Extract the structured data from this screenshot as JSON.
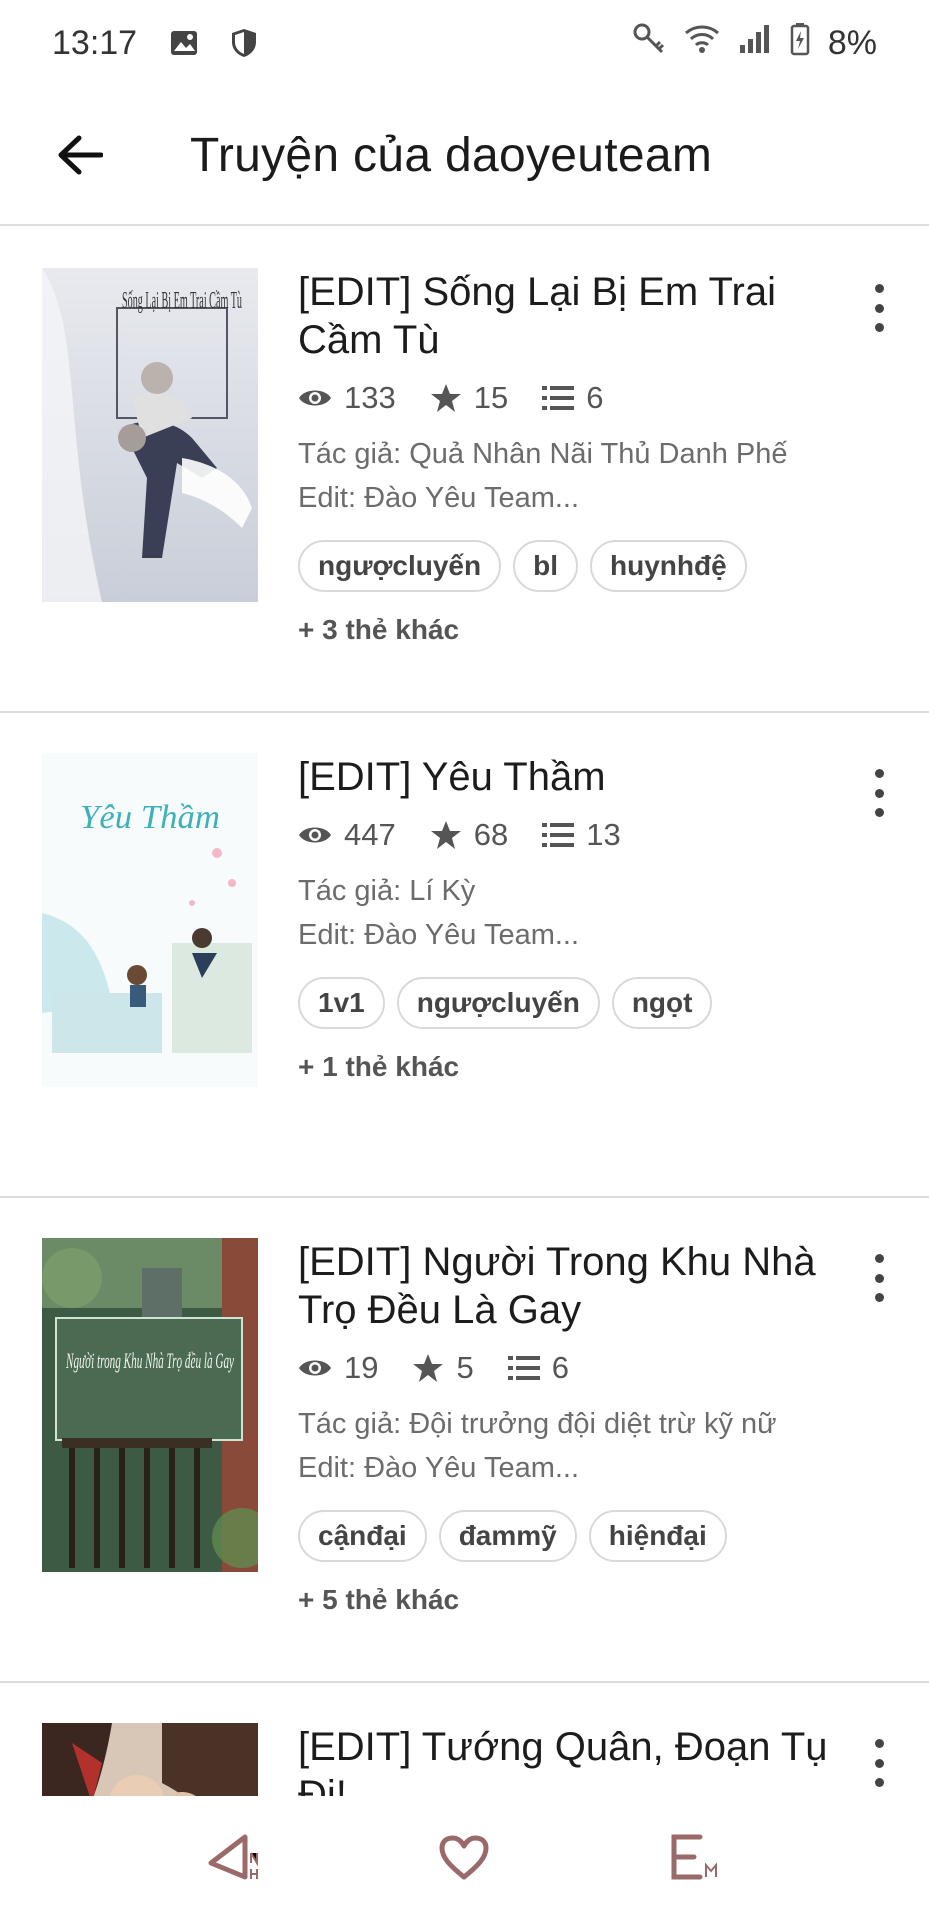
{
  "status": {
    "time": "13:17",
    "battery": "8%"
  },
  "header": {
    "title": "Truyện của daoyeuteam"
  },
  "stories": [
    {
      "title": "[EDIT] Sống Lại Bị Em Trai Cầm Tù",
      "views": "133",
      "votes": "15",
      "parts": "6",
      "author": "Tác giả: Quả Nhân Nãi Thủ Danh Phế",
      "editor": "Edit: Đào Yêu Team...",
      "tags": [
        "ngượcluyến",
        "bl",
        "huynhđệ"
      ],
      "more_tags": "+ 3 thẻ khác",
      "cover_text": "Sống Lại Bị Em Trai Cầm Tù"
    },
    {
      "title": "[EDIT] Yêu Thầm",
      "views": "447",
      "votes": "68",
      "parts": "13",
      "author": "Tác giả: Lí Kỳ",
      "editor": "Edit: Đào Yêu Team...",
      "tags": [
        "1v1",
        "ngượcluyến",
        "ngọt"
      ],
      "more_tags": "+ 1 thẻ khác",
      "cover_text": "Yêu Thầm"
    },
    {
      "title": "[EDIT] Người Trong Khu Nhà Trọ Đều Là Gay",
      "views": "19",
      "votes": "5",
      "parts": "6",
      "author": "Tác giả: Đội trưởng đội diệt trừ kỹ nữ",
      "editor": "Edit: Đào Yêu Team...",
      "tags": [
        "cậnđại",
        "đammỹ",
        "hiệnđại"
      ],
      "more_tags": "+ 5 thẻ khác",
      "cover_text": "Người trong Khu Nhà Trọ đều là Gay"
    },
    {
      "title": "[EDIT] Tướng Quân, Đoạn Tụ Đi!"
    }
  ],
  "colors": {
    "text": "#222222",
    "muted": "#6c6c6c",
    "divider": "#dcdcdc",
    "icon": "#444444",
    "nav": "#9a6a6a"
  }
}
